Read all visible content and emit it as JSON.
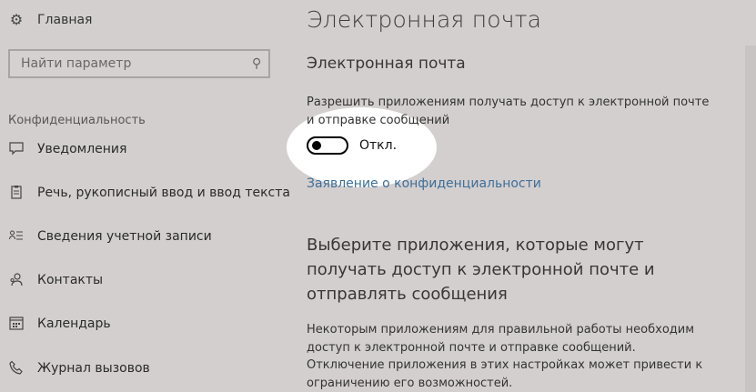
{
  "sidebar": {
    "home": {
      "label": "Главная",
      "icon": "gear-icon"
    },
    "search": {
      "placeholder": "Найти параметр",
      "icon": "search-icon"
    },
    "section_label": "Конфиденциальность",
    "items": [
      {
        "label": "Уведомления",
        "icon": "notification-icon"
      },
      {
        "label": "Речь, рукописный ввод и ввод текста",
        "icon": "clipboard-icon"
      },
      {
        "label": "Сведения учетной записи",
        "icon": "account-info-icon"
      },
      {
        "label": "Контакты",
        "icon": "contacts-icon"
      },
      {
        "label": "Календарь",
        "icon": "calendar-icon"
      },
      {
        "label": "Журнал вызовов",
        "icon": "call-history-icon"
      }
    ]
  },
  "main": {
    "title": "Электронная почта",
    "subtitle": "Электронная почта",
    "description": "Разрешить приложениям получать доступ к электронной почте и отправке сообщений",
    "toggle": {
      "state": "off",
      "label": "Откл."
    },
    "privacy_link": "Заявление о конфиденциальности",
    "apps_heading": "Выберите приложения, которые могут получать доступ к электронной почте и отправлять сообщения",
    "apps_text": "Некоторым приложениям для правильной работы необходим доступ к электронной почте и отправке сообщений. Отключение приложения в этих настройках может привести к ограничению его возможностей."
  },
  "colors": {
    "background": "#d4cfcf",
    "link": "#3e6f99",
    "highlight": "#ffffff"
  }
}
